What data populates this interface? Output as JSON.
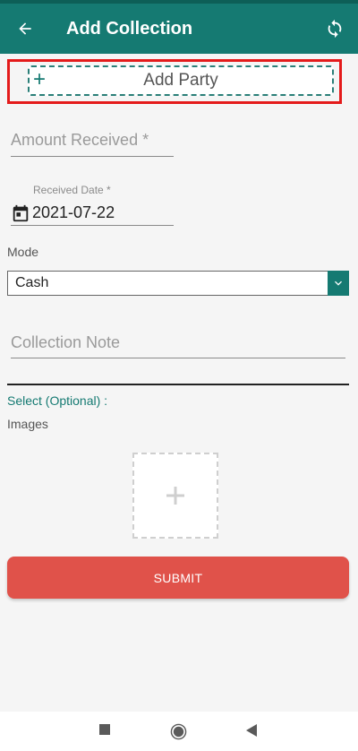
{
  "appbar": {
    "title": "Add Collection"
  },
  "add_party": {
    "label": "Add Party"
  },
  "amount": {
    "placeholder": "Amount Received *"
  },
  "received_date": {
    "label": "Received Date *",
    "value": "2021-07-22"
  },
  "mode": {
    "label": "Mode",
    "selected": "Cash"
  },
  "note": {
    "placeholder": "Collection Note"
  },
  "select_optional": {
    "label": "Select (Optional) :"
  },
  "images": {
    "label": "Images"
  },
  "submit": {
    "label": "SUBMIT"
  },
  "colors": {
    "primary": "#157a72",
    "submit": "#e0524a",
    "highlight": "#e41b1b"
  }
}
